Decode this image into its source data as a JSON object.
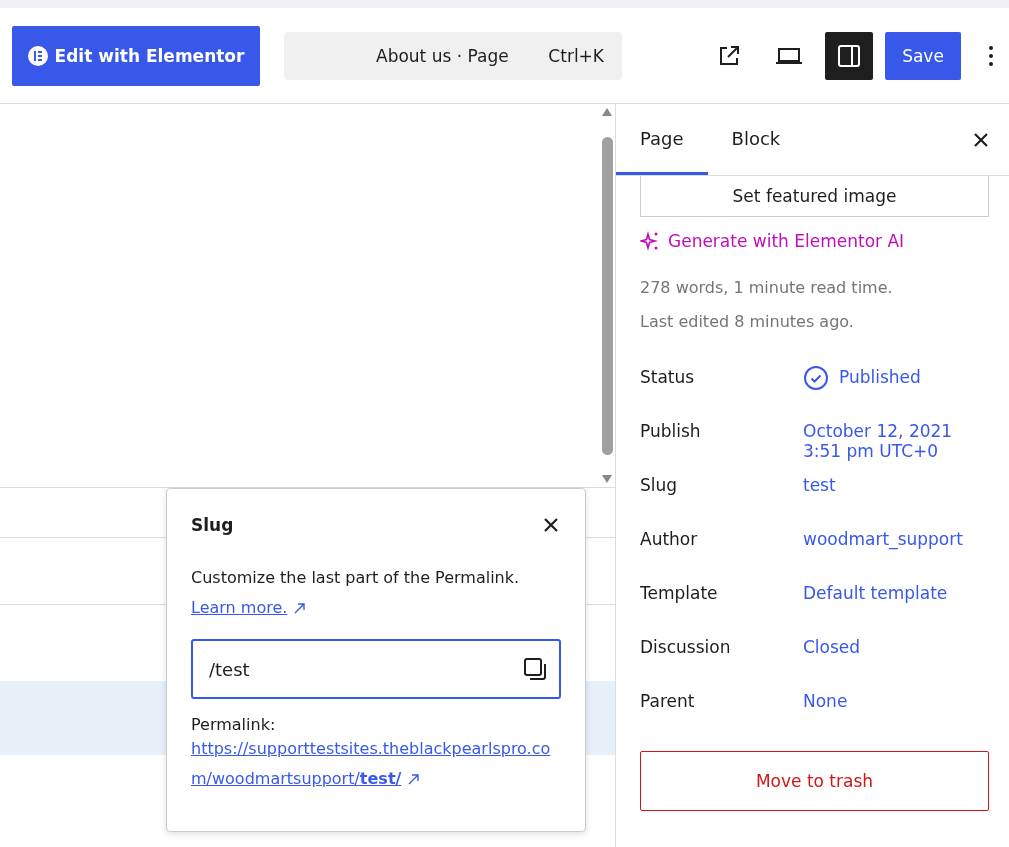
{
  "toolbar": {
    "edit_button": "Edit with Elementor",
    "command": {
      "title": "About us · Page",
      "shortcut": "Ctrl+K"
    },
    "sidebar_toggle": {
      "selected": true
    },
    "save": "Save"
  },
  "sidebar": {
    "tabs": [
      {
        "label": "Page",
        "selected": true
      },
      {
        "label": "Block",
        "selected": false
      }
    ],
    "featured_image_button": "Set featured image",
    "ai_link": "Generate with Elementor AI",
    "stats": [
      "278 words, 1 minute read time.",
      "Last edited 8 minutes ago."
    ],
    "fields": [
      {
        "label": "Status",
        "value": "Published",
        "kind": "status"
      },
      {
        "label": "Publish",
        "value": "October 12, 2021\n3:51 pm UTC+0",
        "kind": "link"
      },
      {
        "label": "Slug",
        "value": "test",
        "kind": "link"
      },
      {
        "label": "Author",
        "value": "woodmart_support",
        "kind": "link"
      },
      {
        "label": "Template",
        "value": "Default template",
        "kind": "link"
      },
      {
        "label": "Discussion",
        "value": "Closed",
        "kind": "link"
      },
      {
        "label": "Parent",
        "value": "None",
        "kind": "link"
      }
    ],
    "trash_button": "Move to trash"
  },
  "slug_popover": {
    "title": "Slug",
    "description": "Customize the last part of the Permalink.",
    "learn_more": "Learn more.",
    "value": "/test",
    "permalink_label": "Permalink:",
    "permalink_url": "https://supporttestsites.theblackpearlspro.com/woodmartsupport/",
    "permalink_slug": "test/"
  }
}
